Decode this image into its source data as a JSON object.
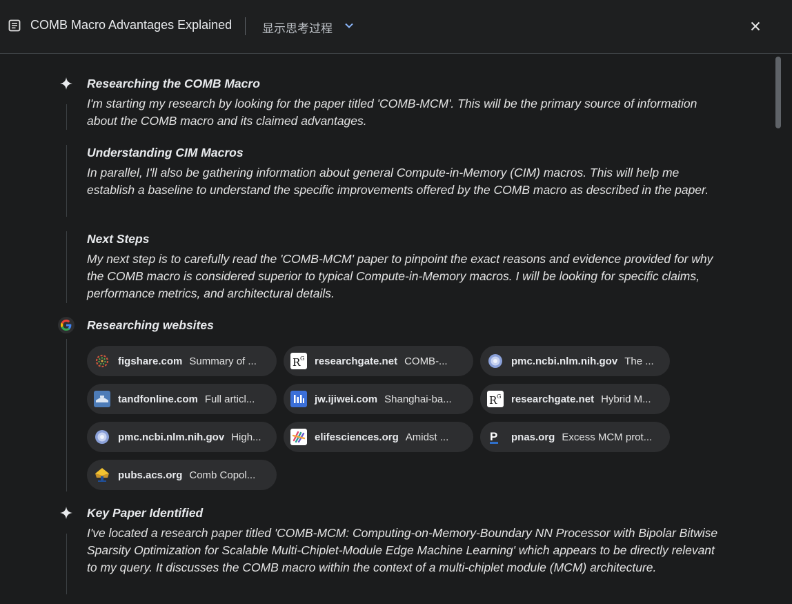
{
  "header": {
    "title": "COMB Macro Advantages Explained",
    "show_thinking": "显示思考过程"
  },
  "sections": [
    {
      "icon": "sparkle-icon",
      "title": "Researching the COMB Macro",
      "body": "I'm starting my research by looking for the paper titled 'COMB-MCM'. This will be the primary source of information about the COMB macro and its claimed advantages."
    },
    {
      "title": "Understanding CIM Macros",
      "body": "In parallel, I'll also be gathering information about general Compute-in-Memory (CIM) macros. This will help me establish a baseline to understand the specific improvements offered by the COMB macro as described in the paper."
    },
    {
      "title": "Next Steps",
      "body": "My next step is to carefully read the 'COMB-MCM' paper to pinpoint the exact reasons and evidence provided for why the COMB macro is considered superior to typical Compute-in-Memory macros. I will be looking for specific claims, performance metrics, and architectural details."
    }
  ],
  "websites": {
    "icon": "google-icon",
    "title": "Researching websites",
    "chips": [
      {
        "domain": "figshare.com",
        "desc": "Summary of ...",
        "icon": "figshare-icon"
      },
      {
        "domain": "researchgate.net",
        "desc": "COMB-...",
        "icon": "researchgate-icon"
      },
      {
        "domain": "pmc.ncbi.nlm.nih.gov",
        "desc": "The ...",
        "icon": "globe-icon"
      },
      {
        "domain": "tandfonline.com",
        "desc": "Full articl...",
        "icon": "tandfonline-icon"
      },
      {
        "domain": "jw.ijiwei.com",
        "desc": "Shanghai-ba...",
        "icon": "ijiwei-icon"
      },
      {
        "domain": "researchgate.net",
        "desc": "Hybrid M...",
        "icon": "researchgate-icon"
      },
      {
        "domain": "pmc.ncbi.nlm.nih.gov",
        "desc": "High...",
        "icon": "globe-icon"
      },
      {
        "domain": "elifesciences.org",
        "desc": "Amidst ...",
        "icon": "elife-icon"
      },
      {
        "domain": "pnas.org",
        "desc": "Excess MCM prot...",
        "icon": "pnas-icon"
      },
      {
        "domain": "pubs.acs.org",
        "desc": "Comb Copol...",
        "icon": "acs-icon"
      }
    ]
  },
  "final_section": {
    "icon": "sparkle-icon",
    "title": "Key Paper Identified",
    "body": "I've located a research paper titled 'COMB-MCM: Computing-on-Memory-Boundary NN Processor with Bipolar Bitwise Sparsity Optimization for Scalable Multi-Chiplet-Module Edge Machine Learning' which appears to be directly relevant to my query. It discusses the COMB macro within the context of a multi-chiplet module (MCM) architecture."
  }
}
